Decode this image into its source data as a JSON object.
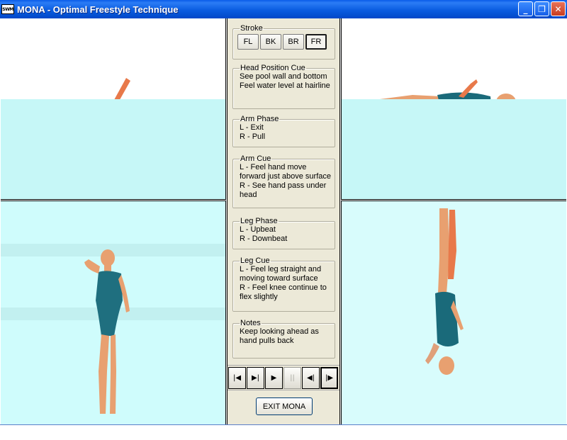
{
  "window": {
    "icon_text": "SWM",
    "title": "MONA - Optimal Freestyle Technique",
    "minimize_glyph": "_",
    "restore_glyph": "❐",
    "close_glyph": "✕"
  },
  "stroke": {
    "title": "Stroke",
    "buttons": [
      {
        "label": "FL",
        "active": false
      },
      {
        "label": "BK",
        "active": false
      },
      {
        "label": "BR",
        "active": false
      },
      {
        "label": "FR",
        "active": true
      }
    ]
  },
  "head_position_cue": {
    "title": "Head Position Cue",
    "text": "See pool wall and bottom\nFeel water level at hairline"
  },
  "arm_phase": {
    "title": "Arm Phase",
    "text": "L - Exit\nR - Pull"
  },
  "arm_cue": {
    "title": "Arm Cue",
    "text": "L - Feel hand move forward just above surface\nR - See hand pass under head"
  },
  "leg_phase": {
    "title": "Leg Phase",
    "text": "L - Upbeat\nR - Downbeat"
  },
  "leg_cue": {
    "title": "Leg Cue",
    "text": "L - Feel leg straight and moving toward surface\nR - Feel knee continue to flex slightly"
  },
  "notes": {
    "title": "Notes",
    "text": "Keep looking ahead as hand pulls back"
  },
  "transport": {
    "first_glyph": "|◀",
    "step_glyph": "▶|",
    "play_glyph": "▶",
    "pause_glyph": "||",
    "back_glyph": "◀|",
    "end_glyph": "|▶"
  },
  "exit_label": "EXIT MONA",
  "colors": {
    "water": "#c6f7f7",
    "skin": "#e8a070",
    "suit": "#1a6a7a",
    "panel": "#ece9d8"
  }
}
